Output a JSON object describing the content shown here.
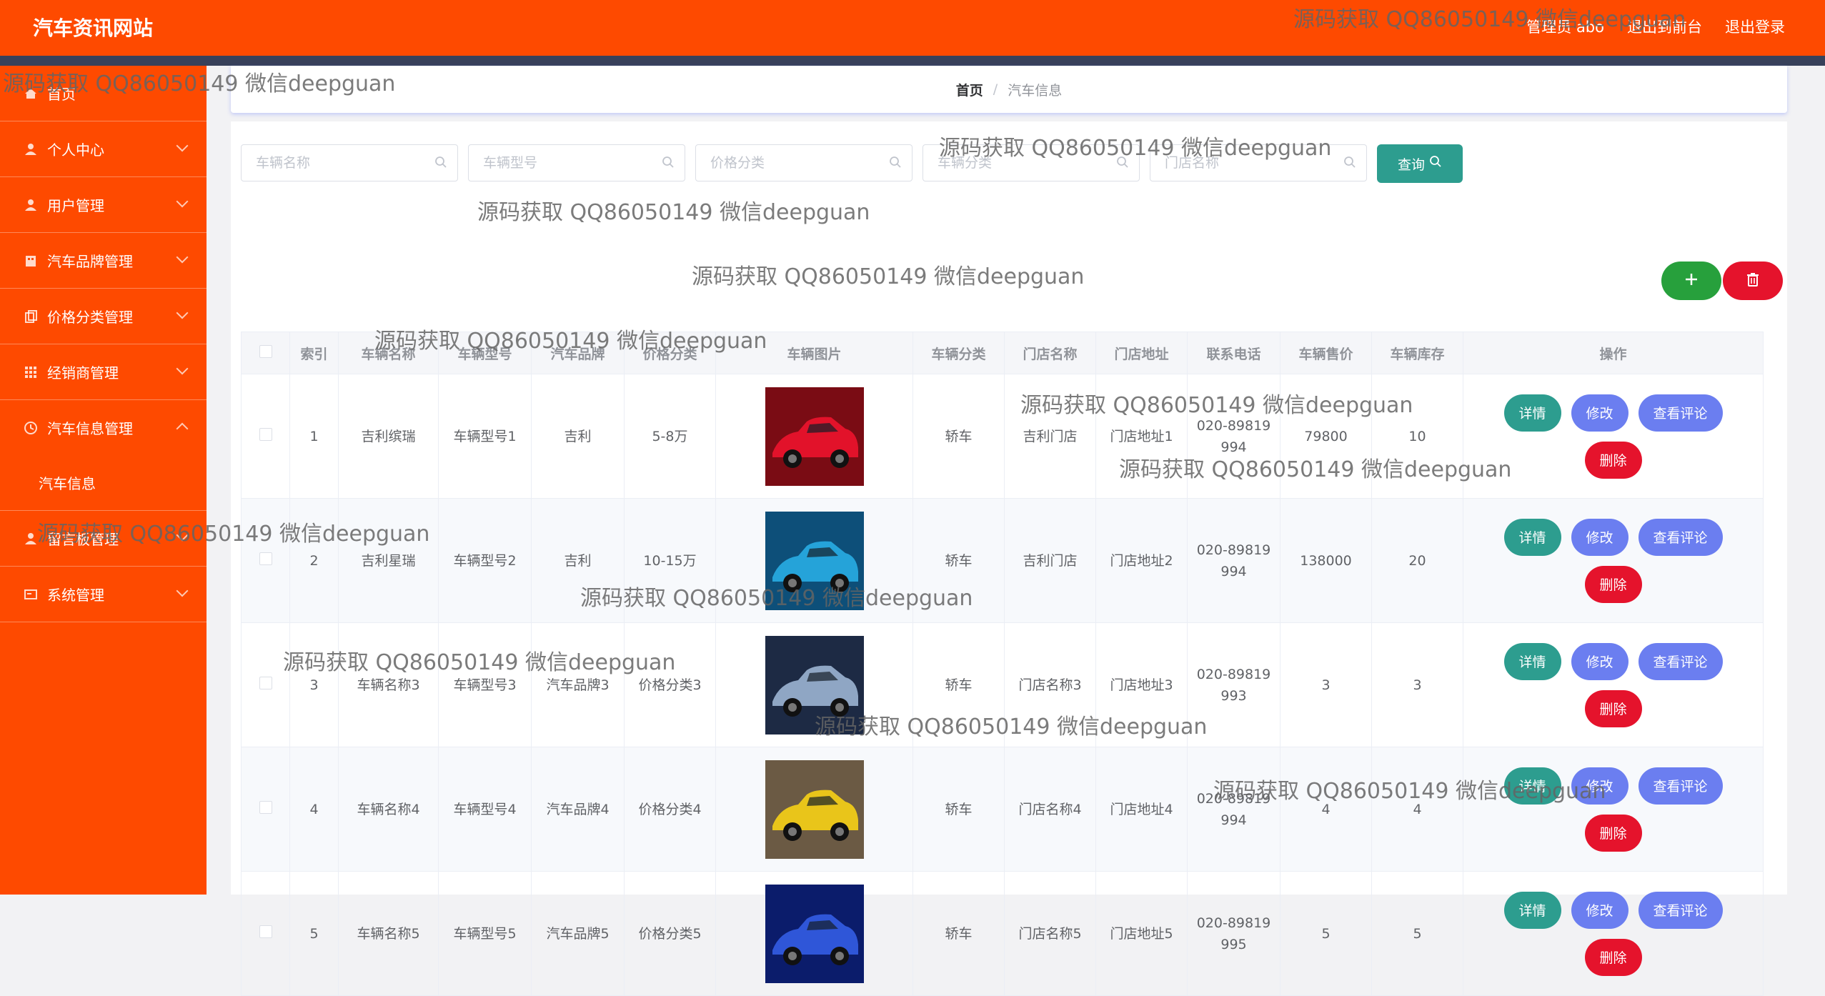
{
  "header": {
    "site_title": "汽车资讯网站",
    "admin_label": "管理员 abo",
    "front_link": "退出到前台",
    "logout_link": "退出登录"
  },
  "sidebar": {
    "items": [
      {
        "label": "首页",
        "icon": "home-icon"
      },
      {
        "label": "个人中心",
        "icon": "person-icon"
      },
      {
        "label": "用户管理",
        "icon": "person-icon"
      },
      {
        "label": "汽车品牌管理",
        "icon": "building-icon"
      },
      {
        "label": "价格分类管理",
        "icon": "copy-icon"
      },
      {
        "label": "经销商管理",
        "icon": "grid-icon"
      },
      {
        "label": "汽车信息管理",
        "icon": "clock-icon"
      },
      {
        "label": "汽车信息",
        "icon": ""
      },
      {
        "label": "留言板管理",
        "icon": "person-icon"
      },
      {
        "label": "系统管理",
        "icon": "card-icon"
      }
    ]
  },
  "breadcrumb": {
    "home": "首页",
    "separator": "/",
    "current": "汽车信息"
  },
  "search": {
    "car_name_placeholder": "车辆名称",
    "car_model_placeholder": "车辆型号",
    "price_category_placeholder": "价格分类",
    "car_category_placeholder": "车辆分类",
    "store_name_placeholder": "门店名称",
    "query_label": "查询"
  },
  "table": {
    "headers": [
      "索引",
      "车辆名称",
      "车辆型号",
      "汽车品牌",
      "价格分类",
      "车辆图片",
      "车辆分类",
      "门店名称",
      "门店地址",
      "联系电话",
      "车辆售价",
      "车辆库存",
      "操作"
    ],
    "rows": [
      {
        "index": "1",
        "name": "吉利缤瑞",
        "model": "车辆型号1",
        "brand": "吉利",
        "price_cat": "5-8万",
        "category": "轿车",
        "store": "吉利门店",
        "address": "门店地址1",
        "phone_a": "020-89819",
        "phone_b": "994",
        "price": "79800",
        "stock": "10",
        "img_colors": [
          "#7a0c14",
          "#e2122a"
        ]
      },
      {
        "index": "2",
        "name": "吉利星瑞",
        "model": "车辆型号2",
        "brand": "吉利",
        "price_cat": "10-15万",
        "category": "轿车",
        "store": "吉利门店",
        "address": "门店地址2",
        "phone_a": "020-89819",
        "phone_b": "994",
        "price": "138000",
        "stock": "20",
        "img_colors": [
          "#0d4f79",
          "#25a3d9"
        ]
      },
      {
        "index": "3",
        "name": "车辆名称3",
        "model": "车辆型号3",
        "brand": "汽车品牌3",
        "price_cat": "价格分类3",
        "category": "轿车",
        "store": "门店名称3",
        "address": "门店地址3",
        "phone_a": "020-89819",
        "phone_b": "993",
        "price": "3",
        "stock": "3",
        "img_colors": [
          "#1d2a44",
          "#8fa6c4"
        ]
      },
      {
        "index": "4",
        "name": "车辆名称4",
        "model": "车辆型号4",
        "brand": "汽车品牌4",
        "price_cat": "价格分类4",
        "category": "轿车",
        "store": "门店名称4",
        "address": "门店地址4",
        "phone_a": "020-89819",
        "phone_b": "994",
        "price": "4",
        "stock": "4",
        "img_colors": [
          "#6b5a44",
          "#e9c51a"
        ]
      },
      {
        "index": "5",
        "name": "车辆名称5",
        "model": "车辆型号5",
        "brand": "汽车品牌5",
        "price_cat": "价格分类5",
        "category": "轿车",
        "store": "门店名称5",
        "address": "门店地址5",
        "phone_a": "020-89819",
        "phone_b": "995",
        "price": "5",
        "stock": "5",
        "img_colors": [
          "#0b1c6b",
          "#2f56d8"
        ]
      }
    ],
    "actions": {
      "detail": "详情",
      "edit": "修改",
      "review": "查看评论",
      "delete": "删除"
    }
  },
  "watermark": "源码获取 QQ86050149 微信deepguan",
  "colors": {
    "primary": "#fe4a00",
    "header_stripe": "#38415a",
    "teal": "#2d9d8f",
    "indigo": "#6b7ef0",
    "green": "#27a03c",
    "red": "#e5132c"
  }
}
